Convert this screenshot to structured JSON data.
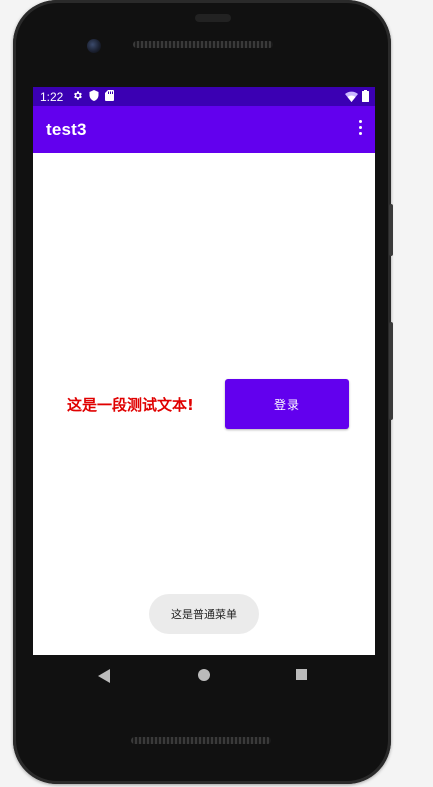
{
  "status_bar": {
    "time": "1:22",
    "left_icons": [
      "gear-icon",
      "shield-icon",
      "sd-card-icon"
    ],
    "right_icons": [
      "wifi-icon",
      "battery-icon"
    ]
  },
  "app_bar": {
    "title": "test3",
    "menu_icon": "more-vert-icon"
  },
  "main": {
    "text": "这是一段测试文本!",
    "text_color": "#e00000",
    "login_button": "登录",
    "button_color": "#6200ee"
  },
  "toast": {
    "message": "这是普通菜单"
  },
  "nav_bar": {
    "icons": [
      "back-icon",
      "home-icon",
      "recents-icon"
    ]
  },
  "colors": {
    "status_bar": "#3b00b3",
    "app_bar": "#6200ee"
  }
}
